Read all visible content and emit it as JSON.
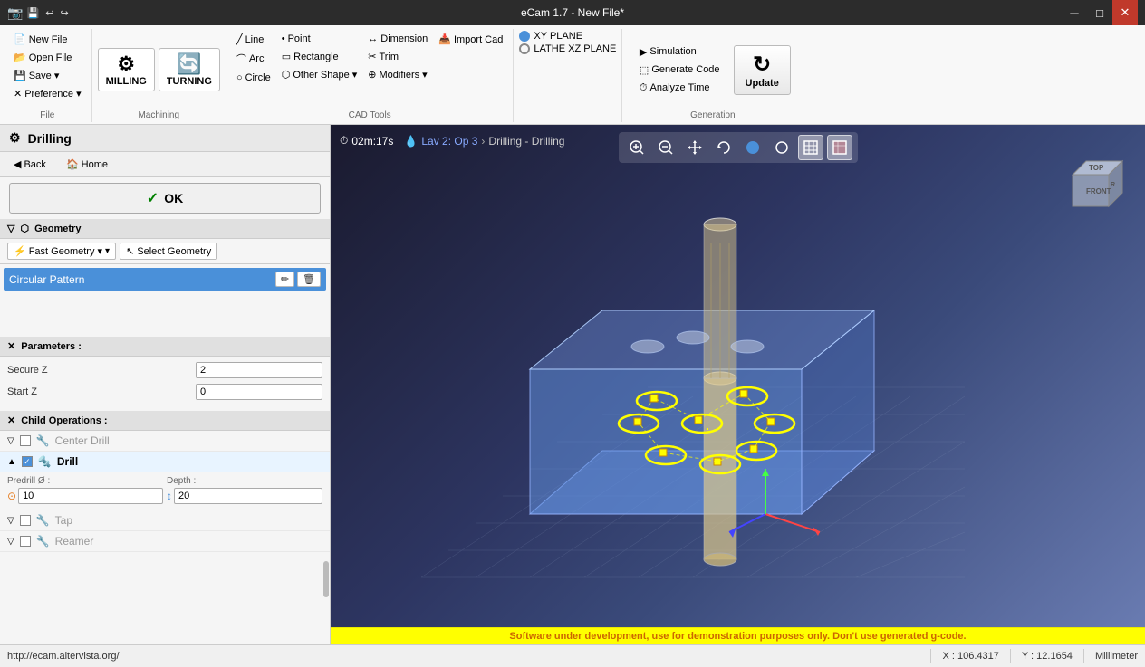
{
  "titlebar": {
    "title": "eCam 1.7 - New File*",
    "icon": "📷",
    "controls": [
      "minimize",
      "maximize",
      "close"
    ]
  },
  "ribbon": {
    "groups": [
      {
        "name": "file",
        "label": "File",
        "items": [
          "New File",
          "Open File",
          "Save ▾",
          "Preference ▾"
        ]
      },
      {
        "name": "machining",
        "label": "Machining",
        "items": [
          "MILLING",
          "TURNING"
        ]
      },
      {
        "name": "cad_tools",
        "label": "CAD Tools",
        "items": [
          "Line",
          "Arc",
          "Circle",
          "Point",
          "Rectangle",
          "Other Shape ▾",
          "Dimension",
          "Trim",
          "Modifiers ▾",
          "Import Cad"
        ]
      },
      {
        "name": "planes",
        "label": "",
        "items": [
          "XY PLANE",
          "LATHE XZ PLANE"
        ]
      },
      {
        "name": "generation",
        "label": "Generation",
        "items": [
          "Simulation",
          "Generate Code",
          "Analyze Time",
          "Update"
        ]
      }
    ]
  },
  "left_panel": {
    "title": "Drilling",
    "title_icon": "⚙",
    "nav": {
      "back_label": "Back",
      "home_label": "Home"
    },
    "ok_label": "✓  OK",
    "sections": {
      "geometry": {
        "label": "Geometry",
        "fast_geometry_label": "Fast Geometry ▾",
        "select_geometry_label": "Select Geometry",
        "items": [
          "Circular Pattern"
        ],
        "edit_tooltip": "Edit",
        "delete_tooltip": "Delete"
      },
      "parameters": {
        "label": "Parameters :",
        "fields": [
          {
            "label": "Secure Z",
            "value": "2"
          },
          {
            "label": "Start Z",
            "value": "0"
          }
        ]
      },
      "child_operations": {
        "label": "Child Operations :",
        "items": [
          {
            "name": "Center Drill",
            "enabled": false,
            "collapsed": false
          },
          {
            "name": "Drill",
            "enabled": true,
            "collapsed": true
          },
          {
            "name": "Tap",
            "enabled": false,
            "collapsed": false
          },
          {
            "name": "Reamer",
            "enabled": false,
            "collapsed": false
          }
        ]
      },
      "drill_params": {
        "predrill_label": "Predrill Ø :",
        "depth_label": "Depth :",
        "predrill_value": "10",
        "depth_value": "20"
      }
    }
  },
  "viewport": {
    "breadcrumb": {
      "timer_icon": "⏱",
      "time": "02m:17s",
      "icon2": "💧",
      "lav": "Lav 2: Op 3",
      "sep": "Drilling - Drilling"
    },
    "toolbar_btns": [
      "🔍+",
      "🔍-",
      "⊕",
      "↩",
      "●",
      "○",
      "▣",
      "▦"
    ],
    "warning": "Software under development, use for demonstration purposes only. Don't use generated g-code."
  },
  "statusbar": {
    "url": "http://ecam.altervista.org/",
    "x_label": "X : 106.4317",
    "y_label": "Y : 12.1654",
    "unit": "Millimeter"
  }
}
